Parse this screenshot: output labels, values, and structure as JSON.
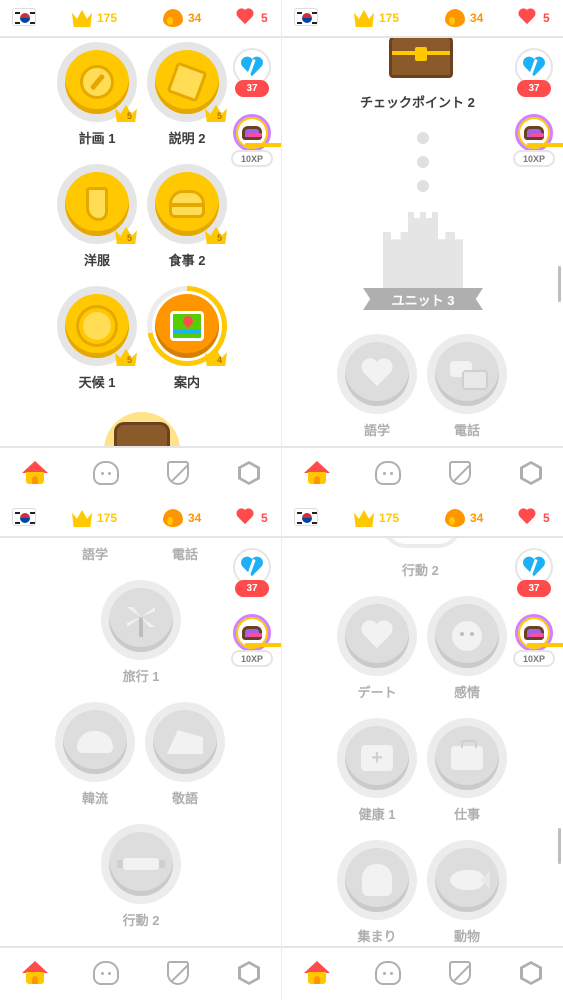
{
  "status_bar": {
    "crowns": "175",
    "streak": "34",
    "hearts": "5",
    "flag": "korea-flag-icon"
  },
  "side_badges": {
    "broken_heart_count": "37",
    "xp_label": "10XP"
  },
  "panel1": {
    "skills": [
      {
        "label": "計画 1",
        "crowns": "5",
        "icon": "compass-icon"
      },
      {
        "label": "説明 2",
        "crowns": "5",
        "icon": "cube-icon"
      },
      {
        "label": "洋服",
        "crowns": "5",
        "icon": "socks-icon"
      },
      {
        "label": "食事 2",
        "crowns": "5",
        "icon": "burger-icon"
      },
      {
        "label": "天候 1",
        "crowns": "5",
        "icon": "sun-icon"
      },
      {
        "label": "案内",
        "crowns": "4",
        "icon": "map-icon"
      }
    ]
  },
  "panel2": {
    "checkpoint_label": "チェックポイント 2",
    "unit_banner": "ユニット 3",
    "skills": [
      {
        "label": "語学",
        "icon": "heart-face-icon"
      },
      {
        "label": "電話",
        "icon": "speech-bubbles-icon"
      }
    ]
  },
  "panel3": {
    "top_labels": [
      "語学",
      "電話"
    ],
    "skills": [
      {
        "label": "旅行 1",
        "icon": "windmill-icon"
      },
      {
        "label": "韓流",
        "icon": "lotus-icon"
      },
      {
        "label": "敬語",
        "icon": "roof-icon"
      },
      {
        "label": "行動 2",
        "icon": "dumbbell-icon"
      }
    ]
  },
  "panel4": {
    "top_label": "行動 2",
    "skills": [
      {
        "label": "デート",
        "icon": "heart-face-icon"
      },
      {
        "label": "感情",
        "icon": "face-icon"
      },
      {
        "label": "健康 1",
        "icon": "first-aid-kit-icon"
      },
      {
        "label": "仕事",
        "icon": "briefcase-icon"
      },
      {
        "label": "集まり",
        "icon": "people-icon"
      },
      {
        "label": "動物",
        "icon": "fish-icon"
      }
    ]
  },
  "nav": {
    "items": [
      "home-icon",
      "characters-icon",
      "shield-icon",
      "shop-hexagon-icon"
    ]
  }
}
